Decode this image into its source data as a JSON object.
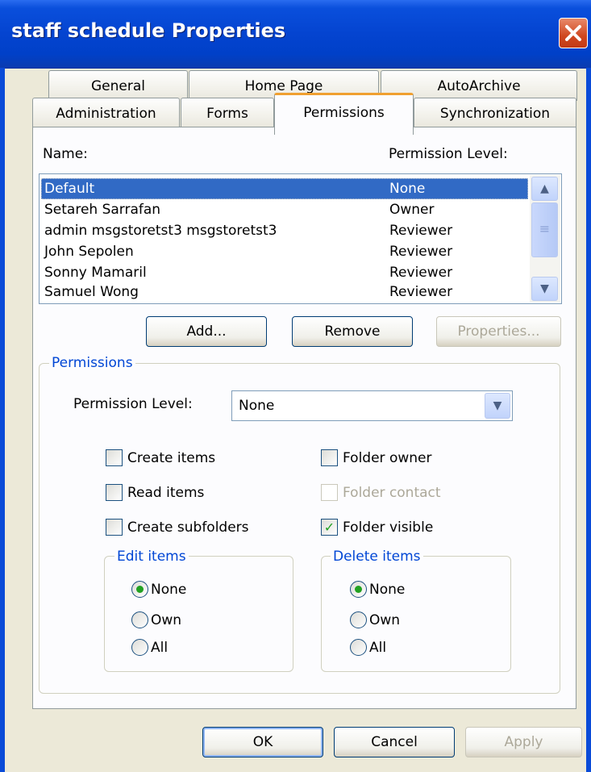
{
  "window": {
    "title": "staff schedule Properties",
    "close_glyph": "✕"
  },
  "tabs": {
    "row1": [
      "General",
      "Home Page",
      "AutoArchive"
    ],
    "row2": [
      "Administration",
      "Forms",
      "Permissions",
      "Synchronization"
    ],
    "active": "Permissions"
  },
  "list": {
    "name_header": "Name:",
    "level_header": "Permission Level:",
    "rows": [
      {
        "name": "Default",
        "level": "None",
        "selected": true
      },
      {
        "name": "Setareh Sarrafan",
        "level": "Owner"
      },
      {
        "name": "admin msgstoretst3 msgstoretst3",
        "level": "Reviewer"
      },
      {
        "name": "John Sepolen",
        "level": "Reviewer"
      },
      {
        "name": "Sonny Mamaril",
        "level": "Reviewer"
      },
      {
        "name": "Samuel Wong",
        "level": "Reviewer"
      }
    ],
    "scroll_up_glyph": "▲",
    "scroll_down_glyph": "▼",
    "scroll_thumb_glyph": "≡"
  },
  "buttons": {
    "add": "Add...",
    "remove": "Remove",
    "properties": "Properties...",
    "ok": "OK",
    "cancel": "Cancel",
    "apply": "Apply"
  },
  "permissions": {
    "group_title": "Permissions",
    "level_label": "Permission Level:",
    "level_value": "None",
    "combo_glyph": "▼",
    "create_items": "Create items",
    "read_items": "Read items",
    "create_subfolders": "Create subfolders",
    "folder_owner": "Folder owner",
    "folder_contact": "Folder contact",
    "folder_visible": "Folder visible",
    "check_glyph": "✓",
    "edit_items": {
      "title": "Edit items",
      "options": [
        "None",
        "Own",
        "All"
      ],
      "selected": "None"
    },
    "delete_items": {
      "title": "Delete items",
      "options": [
        "None",
        "Own",
        "All"
      ],
      "selected": "None"
    }
  },
  "colors": {
    "title_bar": "#0444d0",
    "selection": "#316ac5",
    "group_title": "#0046d5",
    "active_tab_accent": "#f0a030"
  }
}
